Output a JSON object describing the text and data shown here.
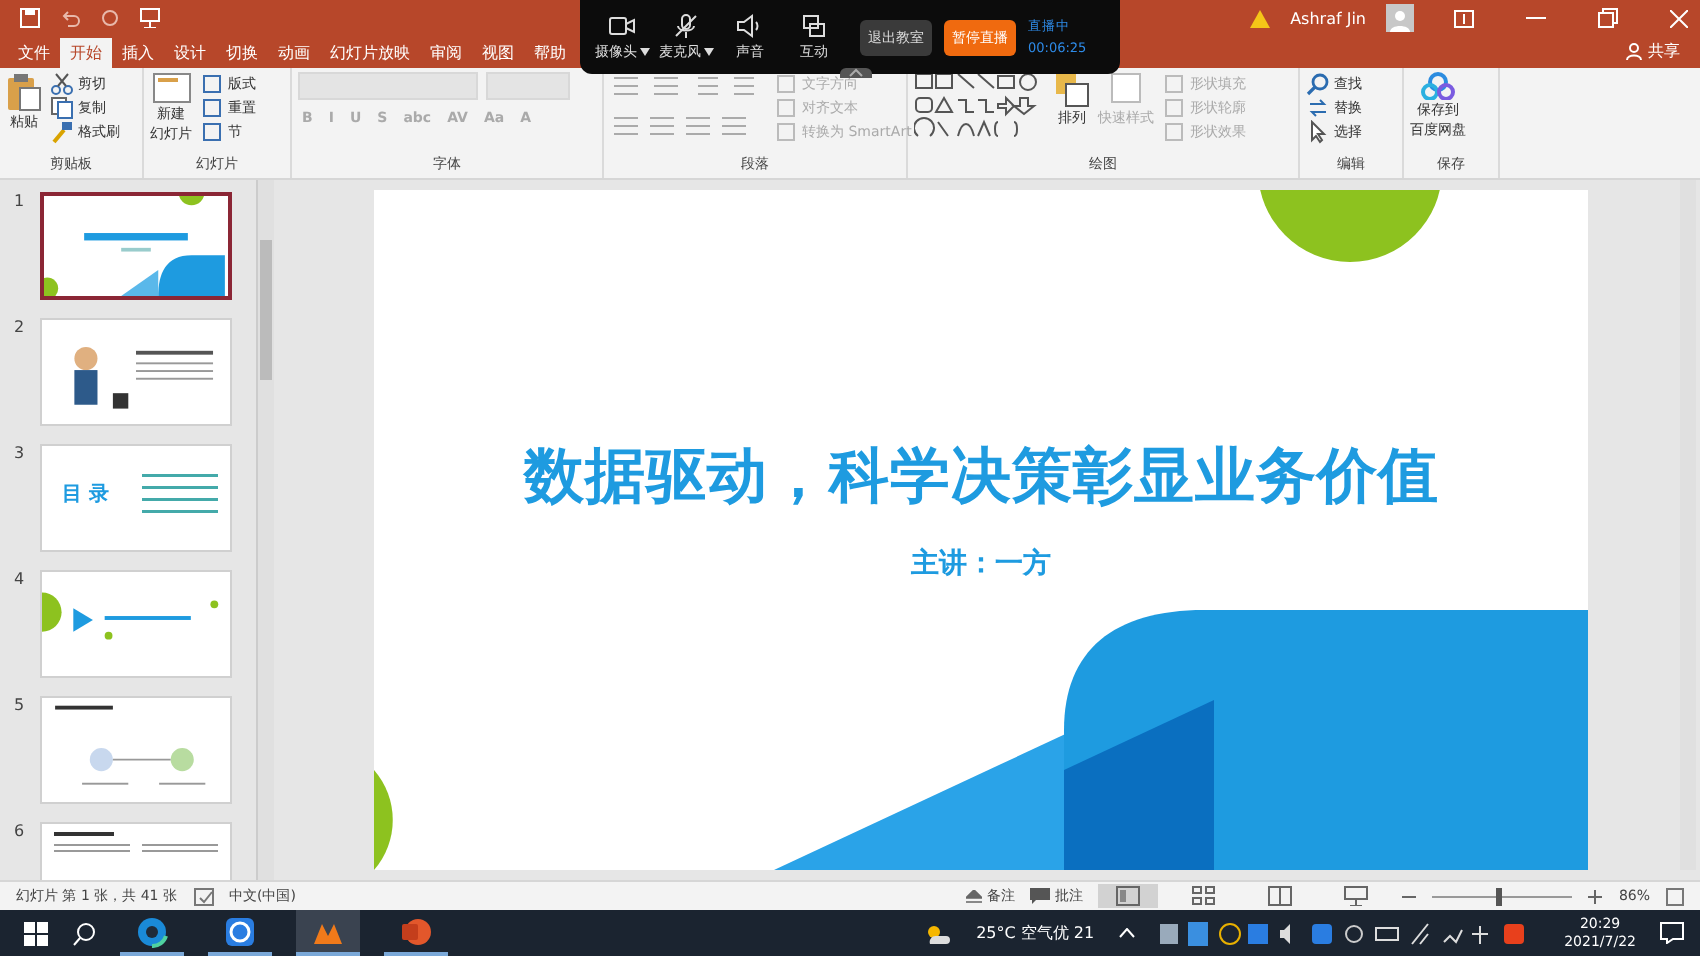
{
  "title_bar": {
    "user": "Ashraf Jin"
  },
  "tabs": [
    {
      "label": "文件",
      "selected": false
    },
    {
      "label": "开始",
      "selected": true
    },
    {
      "label": "插入",
      "selected": false
    },
    {
      "label": "设计",
      "selected": false
    },
    {
      "label": "切换",
      "selected": false
    },
    {
      "label": "动画",
      "selected": false
    },
    {
      "label": "幻灯片放映",
      "selected": false
    },
    {
      "label": "审阅",
      "selected": false
    },
    {
      "label": "视图",
      "selected": false
    },
    {
      "label": "帮助",
      "selected": false
    }
  ],
  "share": "共享",
  "live_toolbar": {
    "tools": [
      {
        "kind": "camera",
        "label": "摄像头",
        "dropdown": true
      },
      {
        "kind": "mic",
        "label": "麦克风",
        "dropdown": true
      },
      {
        "kind": "sound",
        "label": "声音",
        "dropdown": false
      },
      {
        "kind": "interact",
        "label": "互动",
        "dropdown": false
      }
    ],
    "exit_button": "退出教室",
    "pause_button": "暂停直播",
    "status": "直播中",
    "timer": "00:06:25"
  },
  "ribbon": {
    "groups": [
      {
        "kind": "clipboard",
        "label": "剪贴板",
        "big": [
          "粘贴"
        ],
        "items": [
          "剪切",
          "复制",
          "格式刷"
        ]
      },
      {
        "kind": "slides",
        "label": "幻灯片",
        "big": [
          "新建",
          "幻灯片"
        ],
        "items": [
          "版式",
          "重置",
          "节"
        ]
      },
      {
        "kind": "font",
        "label": "字体",
        "disabled": true,
        "buttons": [
          "B",
          "I",
          "U",
          "S",
          "abc",
          "AV",
          "Aa",
          "A"
        ]
      },
      {
        "kind": "paragraph",
        "label": "段落",
        "disabled": true,
        "items": [
          "文字方向",
          "对齐文本",
          "转换为 SmartArt"
        ]
      },
      {
        "kind": "drawing",
        "label": "绘图",
        "big": [
          "排列"
        ],
        "quick_style": "快速样式",
        "disabled": true,
        "items": [
          "形状填充",
          "形状轮廓",
          "形状效果"
        ]
      },
      {
        "kind": "editing",
        "label": "编辑",
        "items": [
          "查找",
          "替换",
          "选择"
        ]
      },
      {
        "kind": "save",
        "label": "保存",
        "big": [
          "保存到",
          "百度网盘"
        ]
      }
    ]
  },
  "thumbnails": [
    {
      "number": "1",
      "kind": "title",
      "selected": true
    },
    {
      "number": "2",
      "kind": "profile",
      "selected": false
    },
    {
      "number": "3",
      "kind": "toc",
      "title": "目 录",
      "selected": false
    },
    {
      "number": "4",
      "kind": "section",
      "selected": false
    },
    {
      "number": "5",
      "kind": "diagram",
      "selected": false
    },
    {
      "number": "6",
      "kind": "text",
      "selected": false
    }
  ],
  "slide": {
    "title": "数据驱动，科学决策彰显业务价值",
    "subtitle": "主讲：一方"
  },
  "status_bar": {
    "slide_info": "幻灯片 第 1 张，共 41 张",
    "language": "中文(中国)",
    "notes": "备注",
    "comments": "批注",
    "views": [
      {
        "kind": "normal",
        "selected": true
      },
      {
        "kind": "sorter",
        "selected": false
      },
      {
        "kind": "reading",
        "selected": false
      },
      {
        "kind": "show",
        "selected": false
      }
    ],
    "zoom": {
      "level": 0.45,
      "reading": "86%"
    }
  },
  "taskbar": {
    "apps": [
      {
        "kind": "browser",
        "selected": false
      },
      {
        "kind": "k",
        "selected": false
      },
      {
        "kind": "m",
        "selected": true
      },
      {
        "kind": "ppt",
        "selected": false
      }
    ],
    "weather": "25°C 空气优 21",
    "time": "20:29",
    "date": "2021/7/22"
  }
}
